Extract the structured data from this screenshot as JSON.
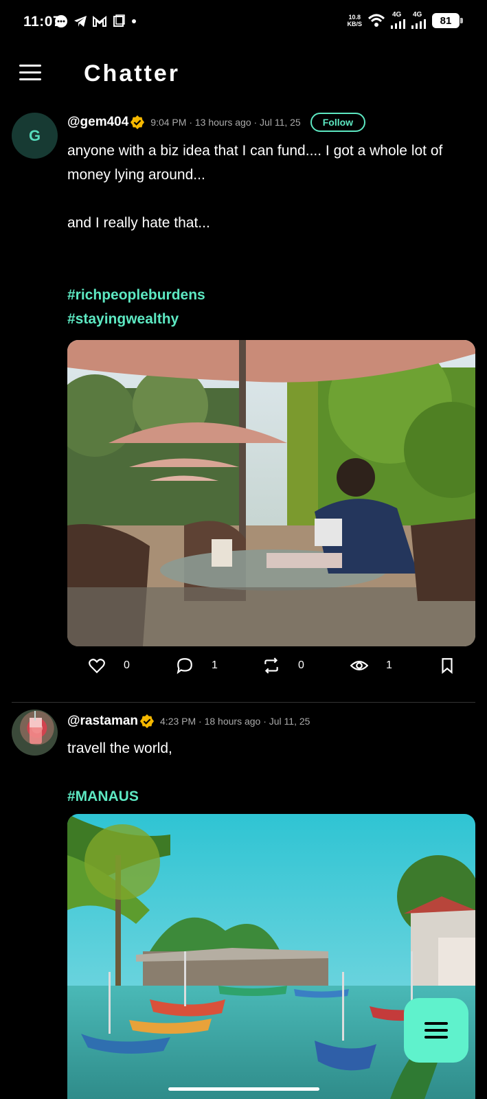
{
  "status_bar": {
    "time": "11:07",
    "speed": "10.8",
    "speed_unit": "KB/S",
    "net1": "4G",
    "net2": "4G",
    "battery": "81"
  },
  "app": {
    "title": "Chatter"
  },
  "posts": [
    {
      "avatar_letter": "G",
      "username": "@gem404",
      "meta": "9:04 PM · 13 hours ago · Jul 11, 25",
      "follow_label": "Follow",
      "text_line1": "anyone with a biz idea that I can fund.... I got a whole lot of money lying around...",
      "text_line2": "and I really hate that...",
      "hashtags": [
        "#richpeopleburdens",
        "#stayingwealthy"
      ],
      "likes": "0",
      "comments": "1",
      "reposts": "0",
      "views": "1"
    },
    {
      "username": "@rastaman",
      "meta": "4:23 PM · 18 hours ago · Jul 11, 25",
      "text": "travell the world,",
      "hashtags": [
        "#MANAUS"
      ]
    }
  ],
  "colors": {
    "accent": "#5de8c2",
    "fab": "#5ff2cc",
    "verified": "#f5b800",
    "background": "#000000"
  }
}
